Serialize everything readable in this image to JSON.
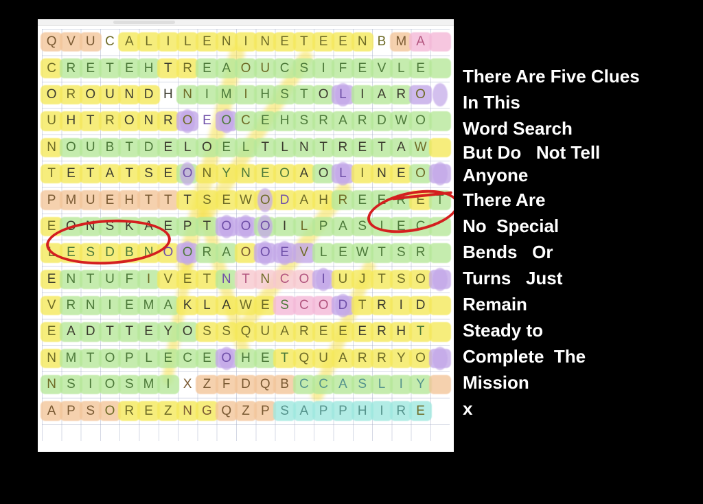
{
  "puzzle": {
    "title": "word-search-grid",
    "rows": 15,
    "cols": 21,
    "grid": [
      "QVUCALILENINETEENBMA ",
      "CRETEHTREAOUCSIFEVLE ",
      "OROUNDHNIMIHSTOLIARO ",
      "UHTRONROEOCEHSRARDWO ",
      "NOUBTDELOELTLNTRETAW ",
      "TETATSEONYNEOAOLINEO ",
      "PMUEHTTTSEWODAHREERET",
      "EONSKAEPTOOOILPASIEC ",
      "LESDBNOORAOOEVLEWTSR ",
      "ENTUFIVETNTNCOIUJTSO ",
      "VRNIEMAKLAWESCODTRID ",
      "EADTTEYOSSQUAREEERHT ",
      "NMTOPLECEOHETQUARRYO ",
      "NSIOSMIXZFDQBCCASLIY ",
      "APSOREZNGQZPSAPPHIRE "
    ],
    "hidden_words_visible": [
      "SAPPHIRE",
      "QUARRY",
      "SQUARE",
      "FIVE",
      "THEUMP",
      "LINE"
    ]
  },
  "annotations": {
    "circled_left": "PMUEHT",
    "circled_right": "LINEO",
    "ink_color": "#d41f1f"
  },
  "clues": {
    "lines": [
      "There Are Five Clues",
      "In This",
      "Word Search",
      "But Do   Not Tell",
      "Anyone",
      "There Are",
      "No  Special",
      "Bends   Or",
      "Turns   Just",
      "Remain",
      "Steady to",
      "Complete  The",
      "Mission",
      "x"
    ],
    "text_color": "#ffffff"
  },
  "palette": {
    "background": "#000000",
    "paper": "#ffffff",
    "yellow": "#f5e95c",
    "green": "#b7e89a",
    "orange": "#f3c69b",
    "purple": "#c3a8e8",
    "pink": "#f4b9d8",
    "pink_light": "#f7c9cf",
    "cyan": "#9fe8df",
    "letter_dark": "#3b3b2e",
    "letter_olive": "#6e6b26",
    "letter_green": "#4d7a3a",
    "letter_brown": "#7a5a33",
    "letter_teal": "#55938c",
    "letter_purple": "#6f4fa8",
    "letter_pink": "#b2557f"
  }
}
